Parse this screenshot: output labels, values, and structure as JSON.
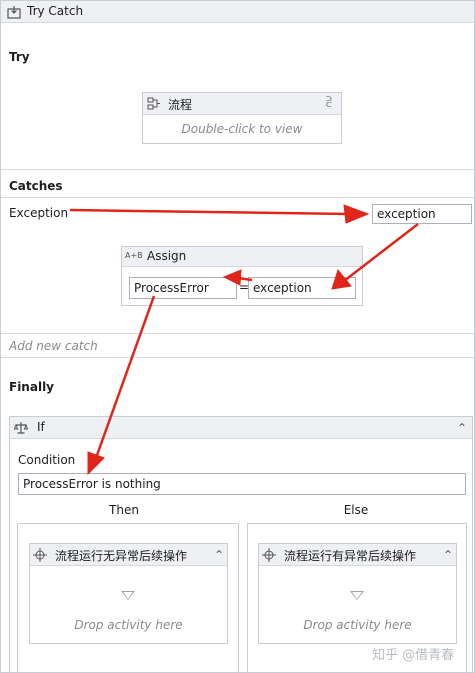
{
  "window": {
    "title": "Try Catch"
  },
  "try": {
    "heading": "Try",
    "sequence": {
      "title": "流程",
      "hint": "Double-click to view"
    }
  },
  "catches": {
    "heading": "Catches",
    "exception_type": "Exception",
    "exception_var": "exception",
    "assign": {
      "title": "Assign",
      "badge": "A+B",
      "to": "ProcessError",
      "equals": "=",
      "value": "exception"
    },
    "add_new_catch": "Add new catch"
  },
  "finally": {
    "heading": "Finally",
    "if": {
      "title": "If",
      "condition_label": "Condition",
      "condition_value": "ProcessError is nothing",
      "then_label": "Then",
      "else_label": "Else",
      "then_activity": {
        "title": "流程运行无异常后续操作",
        "hint": "Drop activity here"
      },
      "else_activity": {
        "title": "流程运行有异常后续操作",
        "hint": "Drop activity here"
      }
    }
  },
  "watermark": "知乎 @借青春",
  "colors": {
    "annotation_arrow": "#e0261b",
    "header_bg": "#eef0f3",
    "border": "#c9ced6"
  }
}
